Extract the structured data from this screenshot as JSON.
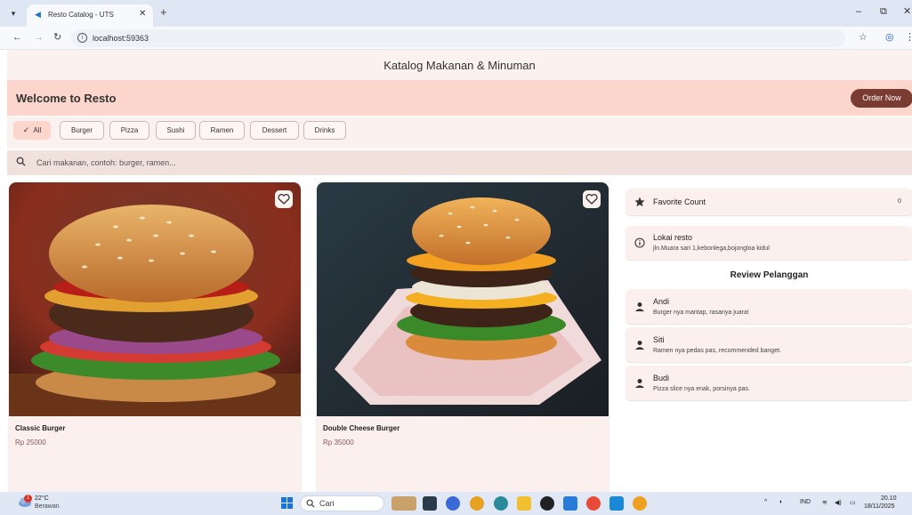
{
  "browser": {
    "tab_title": "Resto Catalog - UTS",
    "url": "localhost:59363"
  },
  "app": {
    "title": "Katalog Makanan & Minuman",
    "welcome": "Welcome to  Resto",
    "order_button": "Order Now",
    "chips": [
      {
        "label": "All",
        "selected": true
      },
      {
        "label": "Burger",
        "selected": false
      },
      {
        "label": "Pizza",
        "selected": false
      },
      {
        "label": "Sushi",
        "selected": false
      },
      {
        "label": "Ramen",
        "selected": false
      },
      {
        "label": "Dessert",
        "selected": false
      },
      {
        "label": "Drinks",
        "selected": false
      }
    ],
    "search_placeholder": "Cari makanan, contoh: burger, ramen...",
    "products": [
      {
        "name": "Classic Burger",
        "price": "Rp 25000",
        "favorite": false
      },
      {
        "name": "Double Cheese Burger",
        "price": "Rp 35000",
        "favorite": false
      }
    ],
    "sidebar": {
      "favorite_label": "Favorite Count",
      "favorite_count": "0",
      "location_title": "Lokai resto",
      "location_address": "jln.Muara sari 1,kebonlega,bojongloa kidul",
      "review_heading": "Review Pelanggan",
      "reviews": [
        {
          "name": "Andi",
          "text": "Burger nya mantap, rasanya juara!"
        },
        {
          "name": "Siti",
          "text": "Ramen nya pedas pas, recommended banget."
        },
        {
          "name": "Budi",
          "text": "Pizza slice nya enak, porsinya pas."
        }
      ]
    }
  },
  "taskbar": {
    "weather_badge": "1",
    "temperature": "22°C",
    "weather": "Berawan",
    "search": "Cari",
    "language": "IND",
    "time": "20.10",
    "date": "18/11/2025"
  },
  "colors": {
    "appbar": "#fbf1ef",
    "welcome": "#fcd6cd",
    "accent": "#7a3b32",
    "card": "#fcf0ee"
  }
}
